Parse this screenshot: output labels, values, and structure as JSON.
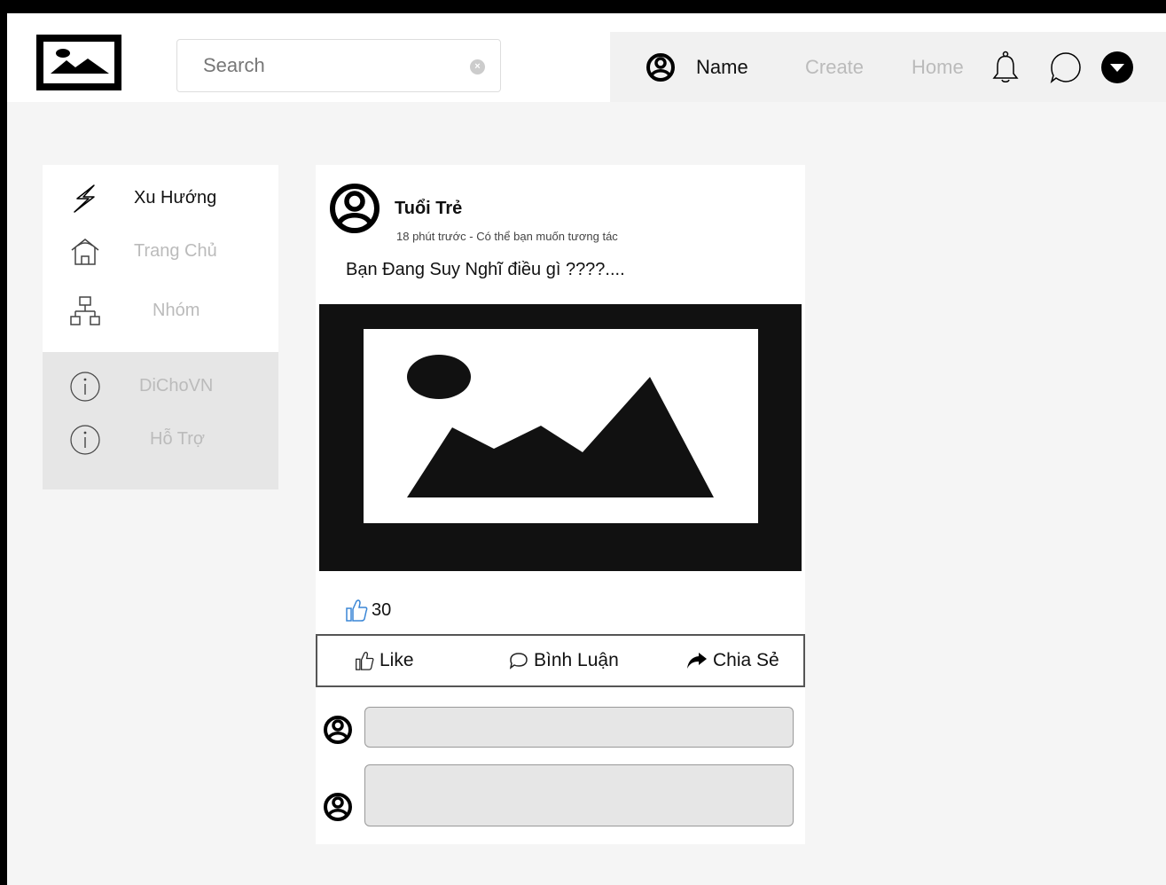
{
  "header": {
    "search": {
      "placeholder": "Search"
    },
    "user_name": "Name",
    "nav": {
      "create": "Create",
      "home": "Home"
    }
  },
  "sidebar": {
    "items": [
      {
        "label": "Xu Hướng",
        "icon": "lightning-icon"
      },
      {
        "label": "Trang Chủ",
        "icon": "home-icon"
      },
      {
        "label": "Nhóm",
        "icon": "group-icon"
      }
    ],
    "secondary": [
      {
        "label": "DiChoVN",
        "icon": "info-icon"
      },
      {
        "label": "Hỗ Trợ",
        "icon": "info-icon"
      }
    ]
  },
  "post": {
    "author": "Tuổi Trẻ",
    "meta": "18 phút trước - Có thể bạn muốn tương tác",
    "text": "Bạn Đang Suy Nghĩ điều gì ????....",
    "like_count": "30",
    "actions": {
      "like": "Like",
      "comment": "Bình Luận",
      "share": "Chia Sẻ"
    }
  },
  "colors": {
    "like_blue": "#3a86d6",
    "active_text": "#111111",
    "inactive_text": "#bbbbbb"
  }
}
